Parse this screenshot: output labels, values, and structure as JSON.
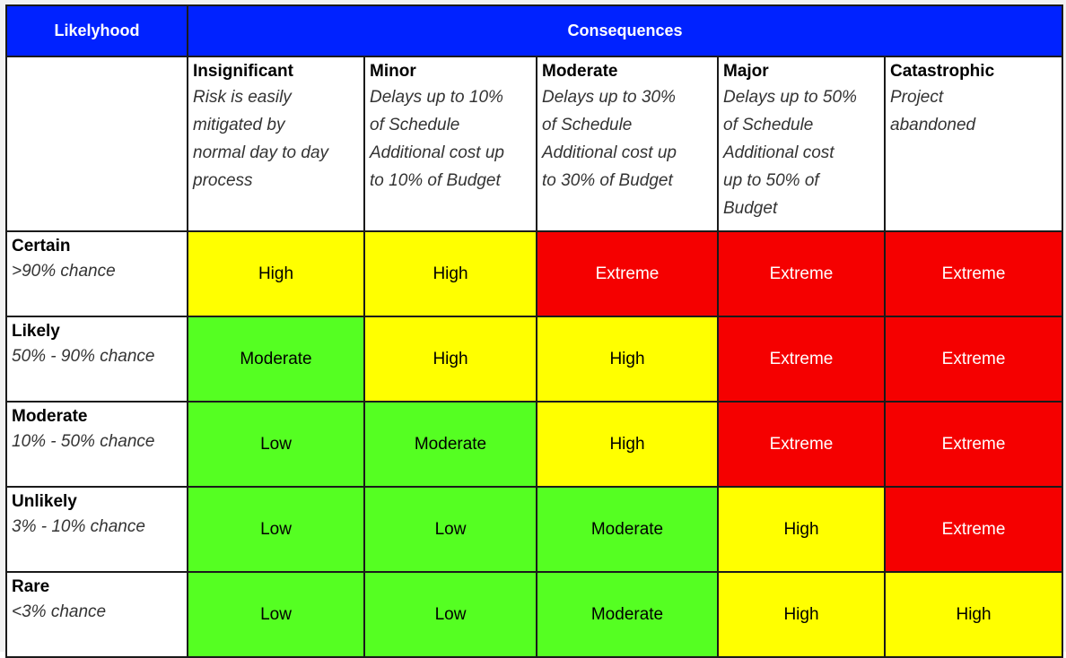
{
  "header": {
    "likelihood_label": "Likelyhood",
    "consequences_label": "Consequences"
  },
  "colors": {
    "header_blue": "#0022ff",
    "low": "#55ff22",
    "moderate": "#55ff22",
    "high": "#ffff00",
    "extreme": "#f50000"
  },
  "consequences": [
    {
      "title": "Insignificant",
      "lines": [
        "Risk is easily",
        "mitigated by",
        "normal day to day",
        "process"
      ]
    },
    {
      "title": "Minor",
      "lines": [
        "Delays up to 10%",
        "of Schedule",
        "Additional cost up",
        "to 10% of Budget"
      ]
    },
    {
      "title": "Moderate",
      "lines": [
        "Delays up to 30%",
        "of Schedule",
        "Additional cost up",
        "to 30% of Budget"
      ]
    },
    {
      "title": "Major",
      "lines": [
        "Delays up to 50%",
        "of Schedule",
        "Additional cost",
        "up to 50% of",
        "Budget"
      ]
    },
    {
      "title": "Catastrophic",
      "lines": [
        "Project",
        "abandoned"
      ]
    }
  ],
  "likelihoods": [
    {
      "title": "Certain",
      "desc": ">90% chance",
      "ratings": [
        "High",
        "High",
        "Extreme",
        "Extreme",
        "Extreme"
      ]
    },
    {
      "title": "Likely",
      "desc": "50% - 90% chance",
      "ratings": [
        "Moderate",
        "High",
        "High",
        "Extreme",
        "Extreme"
      ]
    },
    {
      "title": "Moderate",
      "desc": "10% - 50% chance",
      "ratings": [
        "Low",
        "Moderate",
        "High",
        "Extreme",
        "Extreme"
      ]
    },
    {
      "title": "Unlikely",
      "desc": "3% - 10% chance",
      "ratings": [
        "Low",
        "Low",
        "Moderate",
        "High",
        "Extreme"
      ]
    },
    {
      "title": "Rare",
      "desc": "<3% chance",
      "ratings": [
        "Low",
        "Low",
        "Moderate",
        "High",
        "High"
      ]
    }
  ]
}
